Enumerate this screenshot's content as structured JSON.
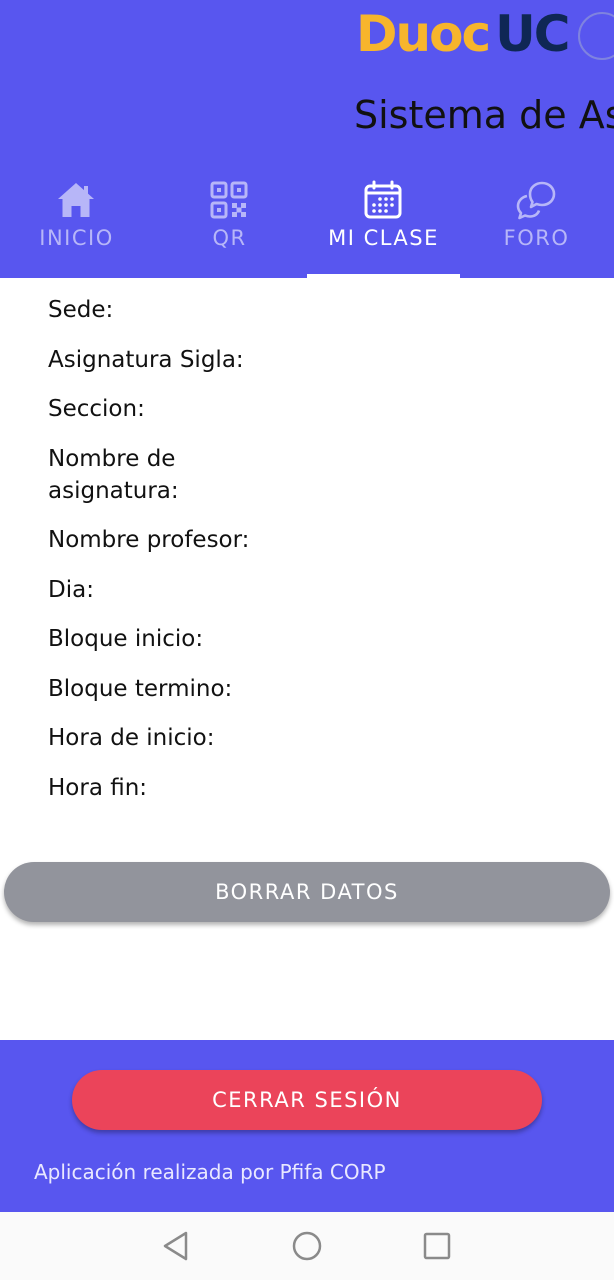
{
  "header": {
    "logo_part1": "Duoc",
    "logo_part2": "UC",
    "title": "Sistema de As",
    "background_color": "#5856ef"
  },
  "tabs": [
    {
      "label": "INICIO",
      "icon": "home-icon",
      "active": false
    },
    {
      "label": "QR",
      "icon": "qr-code-icon",
      "active": false
    },
    {
      "label": "MI CLASE",
      "icon": "calendar-icon",
      "active": true
    },
    {
      "label": "FORO",
      "icon": "chat-bubbles-icon",
      "active": false
    }
  ],
  "class_info": {
    "fields": [
      "Sede:",
      "Asignatura Sigla:",
      "Seccion:",
      "Nombre de asignatura:",
      "Nombre profesor:",
      "Dia:",
      "Bloque inicio:",
      "Bloque termino:",
      "Hora de inicio:",
      "Hora fin:"
    ]
  },
  "actions": {
    "clear_label": "BORRAR DATOS",
    "clear_color": "#92949c"
  },
  "footer": {
    "logout_label": "CERRAR SESIÓN",
    "logout_color": "#eb445a",
    "credit": "Aplicación realizada por Pfifa CORP"
  },
  "system_nav": [
    {
      "icon": "back-triangle-icon"
    },
    {
      "icon": "home-circle-icon"
    },
    {
      "icon": "recents-square-icon"
    }
  ]
}
